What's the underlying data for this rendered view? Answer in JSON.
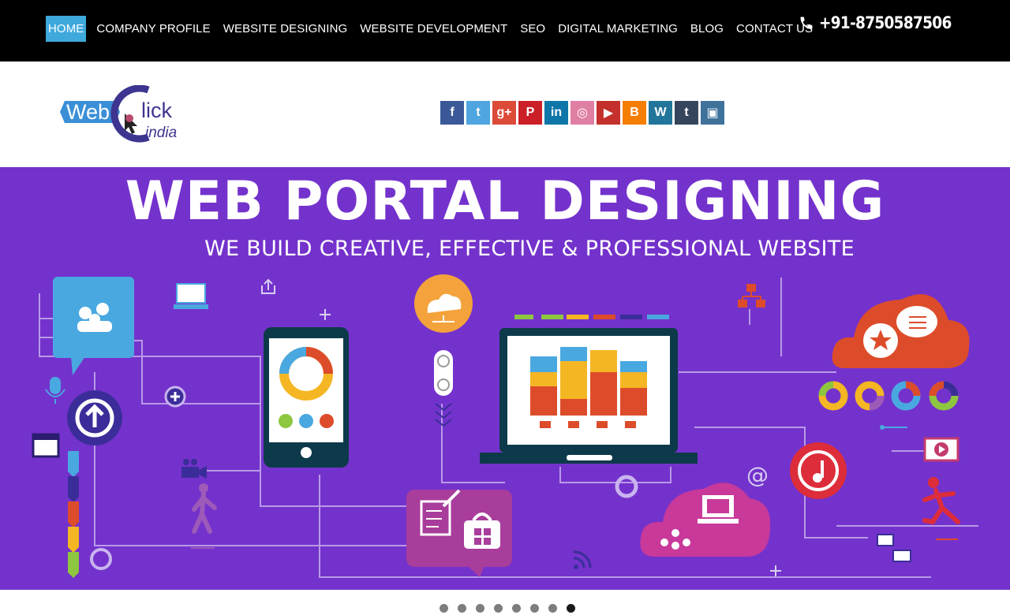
{
  "nav": {
    "items": [
      {
        "label": "HOME",
        "active": true
      },
      {
        "label": "COMPANY PROFILE"
      },
      {
        "label": "WEBSITE DESIGNING"
      },
      {
        "label": "WEBSITE DEVELOPMENT"
      },
      {
        "label": "SEO"
      },
      {
        "label": "DIGITAL MARKETING"
      },
      {
        "label": "BLOG"
      },
      {
        "label": "CONTACT US"
      }
    ],
    "phone": "+91-8750587506",
    "active_color": "#3fa9dc"
  },
  "logo": {
    "part1": "Web",
    "part2": "lick",
    "part3": "india"
  },
  "socials": [
    {
      "name": "facebook-icon",
      "glyph": "f",
      "color": "#3b5998"
    },
    {
      "name": "twitter-icon",
      "glyph": "t",
      "color": "#4fa5e0"
    },
    {
      "name": "google-plus-icon",
      "glyph": "g+",
      "color": "#dc4a38"
    },
    {
      "name": "pinterest-icon",
      "glyph": "P",
      "color": "#cb2027"
    },
    {
      "name": "linkedin-icon",
      "glyph": "in",
      "color": "#0e76a8"
    },
    {
      "name": "dribbble-icon",
      "glyph": "◎",
      "color": "#e07fa4"
    },
    {
      "name": "youtube-icon",
      "glyph": "▶",
      "color": "#c4302b"
    },
    {
      "name": "blogger-icon",
      "glyph": "B",
      "color": "#f57d00"
    },
    {
      "name": "wordpress-icon",
      "glyph": "W",
      "color": "#21759b"
    },
    {
      "name": "tumblr-icon",
      "glyph": "t",
      "color": "#35465c"
    },
    {
      "name": "instagram-icon",
      "glyph": "▣",
      "color": "#3f729b"
    }
  ],
  "banner": {
    "title": "WEB PORTAL DESIGNING",
    "subtitle": "WE BUILD CREATIVE, EFFECTIVE & PROFESSIONAL WEBSITE",
    "background": "#7432cc"
  },
  "slider": {
    "count": 8,
    "active_index": 7
  }
}
